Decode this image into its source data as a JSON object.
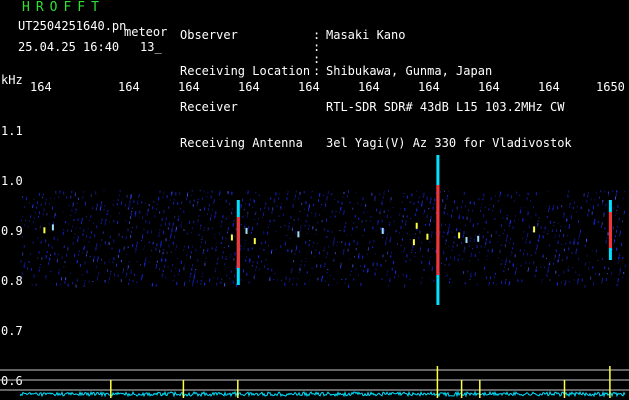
{
  "header": {
    "brand": "HROFFT",
    "filename": "UT2504251640.pn",
    "tag": "meteor",
    "datetime": "25.04.25 16:40",
    "count": "13_",
    "labels": [
      "Observer",
      "Receiving Location",
      "Receiver",
      "Receiving Antenna"
    ],
    "values": [
      "Masaki Kano",
      "Shibukawa, Gunma, Japan",
      "RTL-SDR SDR# 43dB L15 103.2MHz CW",
      "3el Yagi(V) Az 330 for Vladivostok"
    ]
  },
  "axes": {
    "y_unit": "kHz",
    "x_tick_labels": [
      "164",
      "164",
      "164",
      "164",
      "164",
      "164",
      "164",
      "164",
      "164",
      "1650"
    ],
    "y_tick_labels": [
      "1.1",
      "1.0",
      "0.9",
      "0.8",
      "0.7",
      "0.6"
    ]
  },
  "colors": {
    "background": "#000000",
    "noise": "#1a2cff",
    "signal_hot": "#ff3030",
    "signal_warm": "#ffff40",
    "trace": "#00e0ff",
    "header_green": "#30e030"
  },
  "chart_data": {
    "type": "heatmap",
    "ylabel": "kHz",
    "ylim": [
      0.58,
      1.15
    ],
    "noise_band": [
      0.79,
      0.98
    ],
    "strong_echoes": [
      {
        "x_index": 0.69,
        "y_range": [
          0.75,
          1.05
        ]
      },
      {
        "x_index": 0.975,
        "y_range": [
          0.84,
          0.96
        ]
      },
      {
        "x_index": 0.36,
        "y_range": [
          0.79,
          0.96
        ]
      }
    ]
  }
}
